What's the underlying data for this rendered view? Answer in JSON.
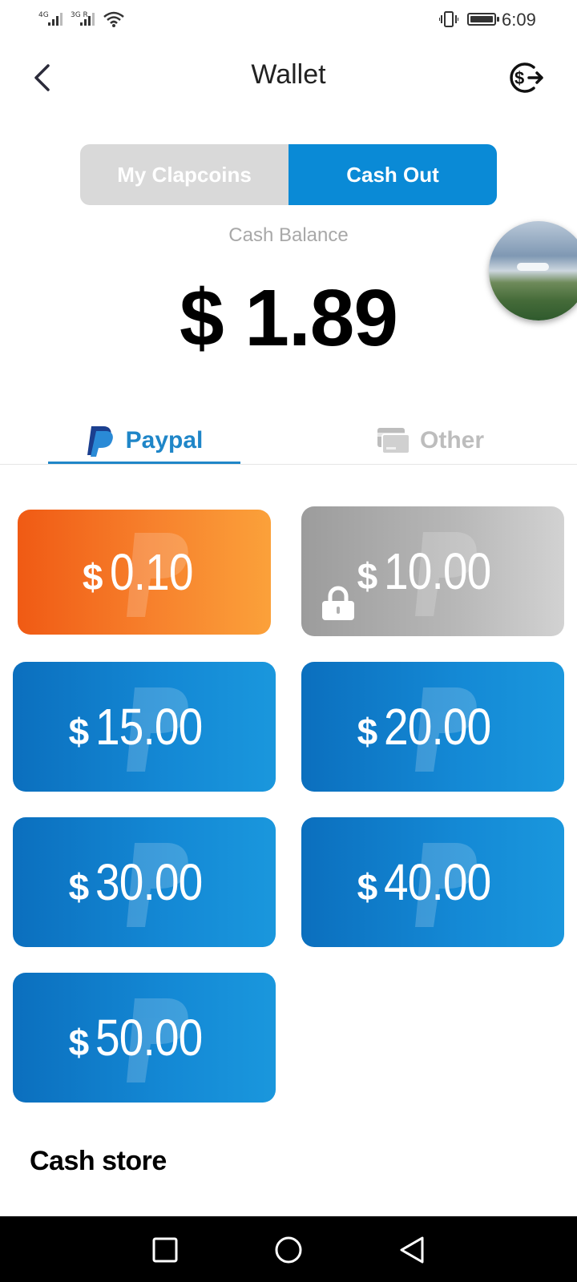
{
  "status_bar": {
    "sim1": "4G",
    "sim2": "3G R",
    "time": "6:09"
  },
  "header": {
    "title": "Wallet",
    "back_icon": "chevron-left-icon",
    "cashout_icon": "dollar-exchange-icon"
  },
  "segment": {
    "tab_1": "My Clapcoins",
    "tab_2": "Cash Out",
    "active": "Cash Out"
  },
  "balance": {
    "label": "Cash Balance",
    "value": "$ 1.89"
  },
  "methods": {
    "paypal_label": "Paypal",
    "other_label": "Other",
    "active": "Paypal"
  },
  "amounts": [
    {
      "currency": "$",
      "value": "0.10",
      "state": "available",
      "color": "#f7822d"
    },
    {
      "currency": "$",
      "value": "10.00",
      "state": "locked",
      "color": "#b8b8b8"
    },
    {
      "currency": "$",
      "value": "15.00",
      "state": "available",
      "color": "#1489d5"
    },
    {
      "currency": "$",
      "value": "20.00",
      "state": "available",
      "color": "#1489d5"
    },
    {
      "currency": "$",
      "value": "30.00",
      "state": "available",
      "color": "#1489d5"
    },
    {
      "currency": "$",
      "value": "40.00",
      "state": "available",
      "color": "#1489d5"
    },
    {
      "currency": "$",
      "value": "50.00",
      "state": "available",
      "color": "#1489d5"
    }
  ],
  "section": {
    "cash_store": "Cash store"
  },
  "colors": {
    "accent": "#0a8ad6",
    "paypal_blue": "#1f86c8"
  }
}
